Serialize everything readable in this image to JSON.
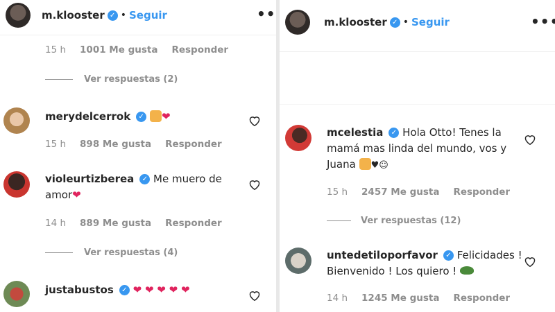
{
  "left": {
    "header": {
      "username": "m.klooster",
      "follow_label": "Seguir",
      "more_label": "•••"
    },
    "first_meta": {
      "time": "15 h",
      "likes": "1001 Me gusta",
      "reply": "Responder"
    },
    "view_replies_1": "Ver respuestas (2)",
    "comments": [
      {
        "username": "merydelcerrok",
        "text": "",
        "time": "15 h",
        "likes": "898 Me gusta",
        "reply": "Responder"
      },
      {
        "username": "violeurtizberea",
        "text": "Me muero de amor",
        "time": "14 h",
        "likes": "889 Me gusta",
        "reply": "Responder",
        "replies": "Ver respuestas (4)"
      },
      {
        "username": "justabustos",
        "text": ""
      }
    ]
  },
  "right": {
    "header": {
      "username": "m.klooster",
      "follow_label": "Seguir",
      "more_label": "•••"
    },
    "comments": [
      {
        "username": "mcelestia",
        "text": "Hola Otto! Tenes la mamá mas linda del mundo, vos y Juana",
        "time": "15 h",
        "likes": "2457 Me gusta",
        "reply": "Responder",
        "replies": "Ver respuestas (12)"
      },
      {
        "username": "untedetiloporfavor",
        "text": "Felicidades ! Bienvenido ! Los quiero !",
        "time": "14 h",
        "likes": "1245 Me gusta",
        "reply": "Responder"
      }
    ]
  },
  "colors": {
    "accent": "#3897f0",
    "heart": "#e0245e",
    "muted": "#8e8e8e",
    "text": "#262626"
  },
  "icons": {
    "verified": "verified-badge-icon",
    "like": "heart-outline-icon",
    "more": "more-options-icon"
  }
}
